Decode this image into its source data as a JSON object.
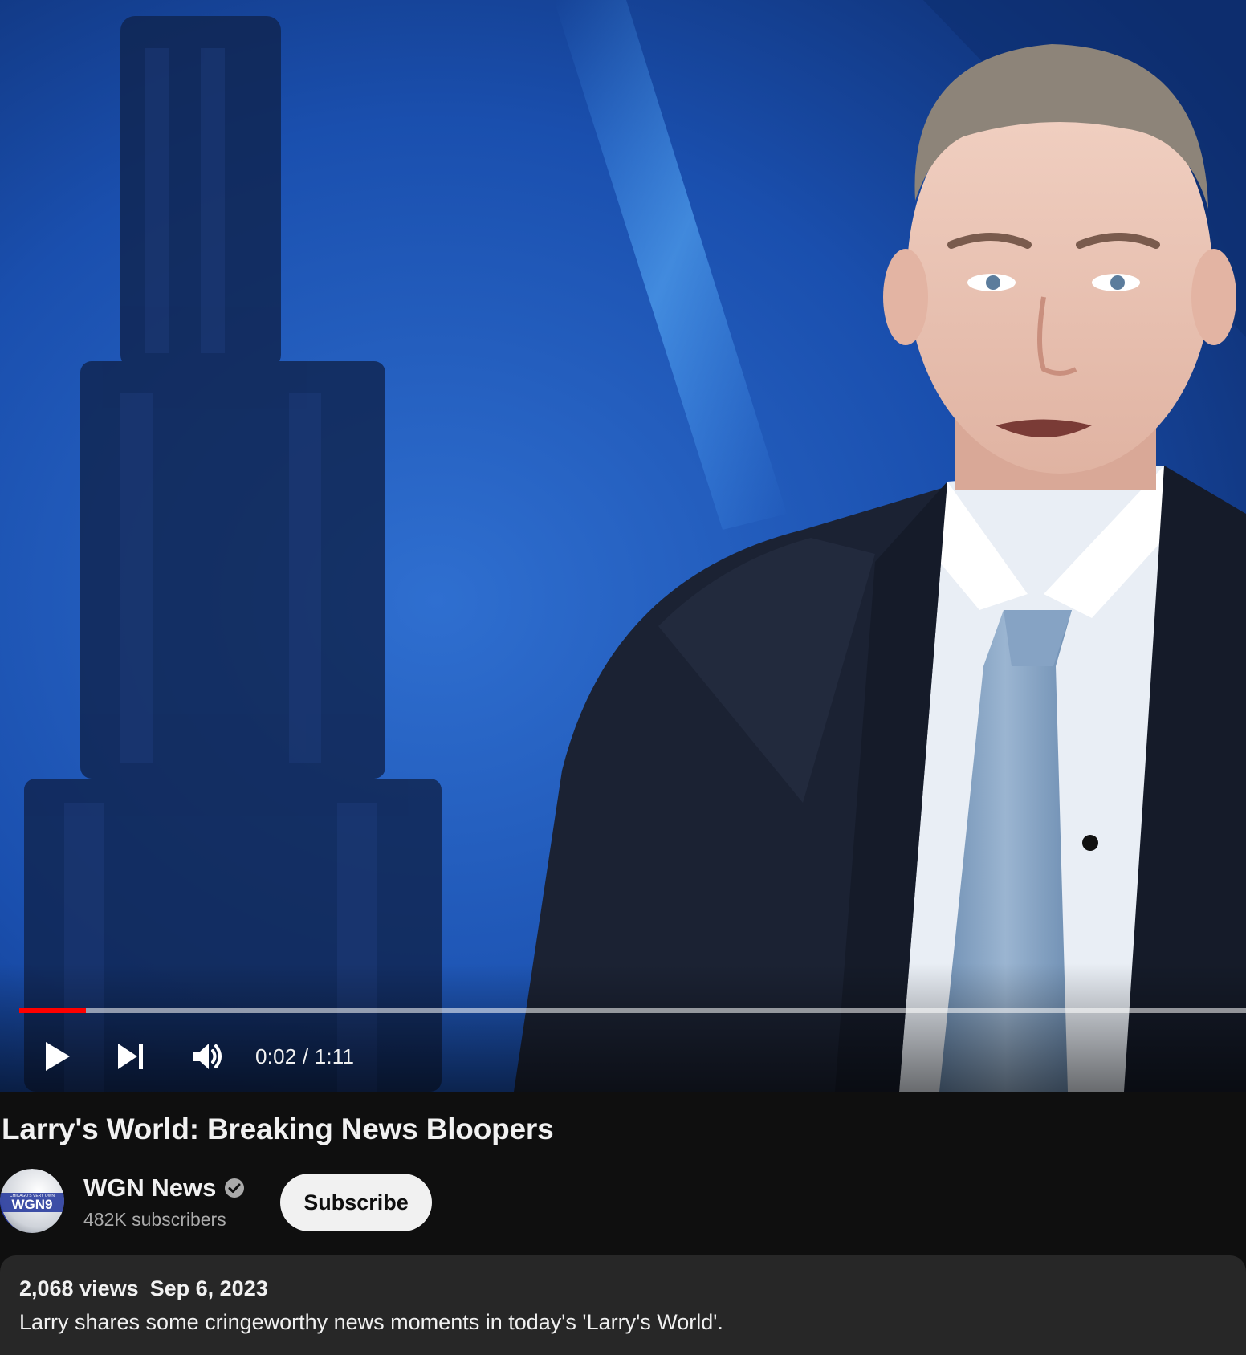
{
  "player": {
    "current_time": "0:02",
    "duration": "1:11",
    "time_separator": " / ",
    "progress_fraction": 0.054,
    "progress_color": "#ff0000",
    "buttons": {
      "play": "play-icon",
      "next": "skip-next-icon",
      "volume": "volume-icon"
    }
  },
  "video": {
    "title": "Larry's World: Breaking News Bloopers"
  },
  "channel": {
    "name": "WGN News",
    "verified_icon": "verified-check-icon",
    "subscribers": "482K subscribers",
    "avatar_lines": [
      "CHICAGO'S VERY OWN",
      "WGN9"
    ],
    "subscribe_label": "Subscribe"
  },
  "description": {
    "views": "2,068 views",
    "date": "Sep 6, 2023",
    "text": "Larry shares some cringeworthy news moments in today's 'Larry's World'."
  }
}
